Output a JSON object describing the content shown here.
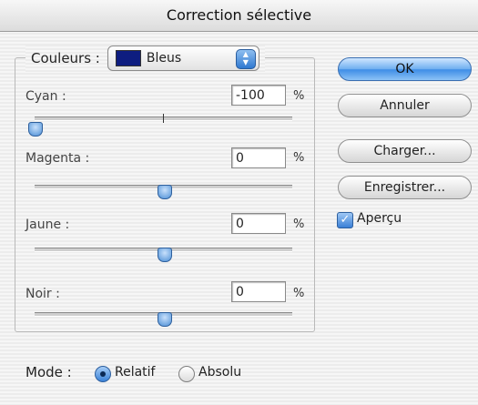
{
  "window": {
    "title": "Correction sélective"
  },
  "colors": {
    "label": "Couleurs :",
    "selected": "Bleus",
    "swatch_color": "#0e1d80"
  },
  "sliders": [
    {
      "label": "Cyan :",
      "value": "-100",
      "unit": "%",
      "position_percent": 0
    },
    {
      "label": "Magenta :",
      "value": "0",
      "unit": "%",
      "position_percent": 50
    },
    {
      "label": "Jaune :",
      "value": "0",
      "unit": "%",
      "position_percent": 50
    },
    {
      "label": "Noir :",
      "value": "0",
      "unit": "%",
      "position_percent": 50
    }
  ],
  "buttons": {
    "ok": "OK",
    "cancel": "Annuler",
    "load": "Charger...",
    "save": "Enregistrer..."
  },
  "preview": {
    "label": "Aperçu",
    "checked": true
  },
  "mode": {
    "label": "Mode :",
    "relative": "Relatif",
    "absolute": "Absolu",
    "selected": "relative"
  },
  "accent_color": "#3d8ce6"
}
